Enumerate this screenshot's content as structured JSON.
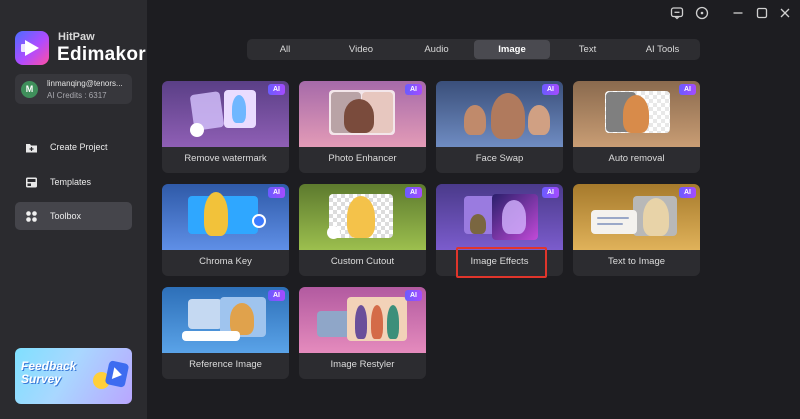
{
  "app": {
    "brand_top": "HitPaw",
    "brand_main": "Edimakor"
  },
  "account": {
    "avatar_letter": "M",
    "email": "linmanqing@tenors...",
    "credits": "AI Credits : 6317"
  },
  "nav": [
    {
      "label": "Create Project",
      "icon": "folder-plus-icon",
      "active": false
    },
    {
      "label": "Templates",
      "icon": "templates-icon",
      "active": false
    },
    {
      "label": "Toolbox",
      "icon": "toolbox-icon",
      "active": true
    }
  ],
  "feedback": {
    "text": "Feedback Survey"
  },
  "titlebar": {
    "icons": [
      "feedback-icon",
      "info-icon",
      "minimize-icon",
      "maximize-icon",
      "close-icon"
    ]
  },
  "tabs": [
    "All",
    "Video",
    "Audio",
    "Image",
    "Text",
    "AI Tools"
  ],
  "active_tab": "Image",
  "badge": "AI",
  "cards": [
    {
      "label": "Remove watermark"
    },
    {
      "label": "Photo Enhancer"
    },
    {
      "label": "Face Swap"
    },
    {
      "label": "Auto removal"
    },
    {
      "label": "Chroma Key"
    },
    {
      "label": "Custom Cutout"
    },
    {
      "label": "Image Effects"
    },
    {
      "label": "Text to Image"
    },
    {
      "label": "Reference Image"
    },
    {
      "label": "Image Restyler"
    }
  ],
  "colors": {
    "background": "#1d1d21",
    "sidebar": "#2b2b2f",
    "highlight": "#e0352b",
    "ai_badge": "#8a52ff"
  }
}
